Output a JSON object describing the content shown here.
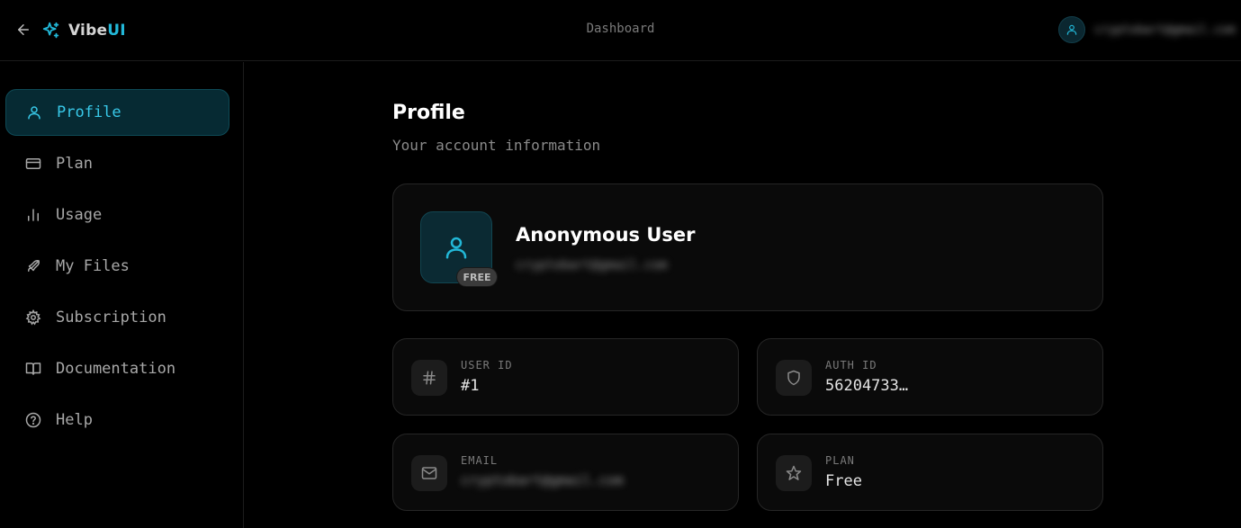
{
  "brand": {
    "name_part1": "Vibe",
    "name_part2": "UI"
  },
  "header": {
    "title": "Dashboard",
    "user_email": "cryptobart@gmail.com"
  },
  "sidebar": {
    "items": [
      {
        "label": "Profile",
        "icon": "user-icon",
        "active": true
      },
      {
        "label": "Plan",
        "icon": "credit-card-icon"
      },
      {
        "label": "Usage",
        "icon": "bar-chart-icon"
      },
      {
        "label": "My Files",
        "icon": "rocket-icon"
      },
      {
        "label": "Subscription",
        "icon": "gear-icon"
      },
      {
        "label": "Documentation",
        "icon": "book-icon"
      },
      {
        "label": "Help",
        "icon": "help-circle-icon"
      }
    ]
  },
  "main": {
    "title": "Profile",
    "subtitle": "Your account information",
    "profile_card": {
      "name": "Anonymous User",
      "email": "cryptobart@gmail.com",
      "badge": "FREE"
    },
    "info": {
      "user_id": {
        "label": "USER ID",
        "value": "#1",
        "icon": "hash-icon"
      },
      "auth_id": {
        "label": "AUTH ID",
        "value": "56204733…",
        "icon": "shield-icon"
      },
      "email": {
        "label": "EMAIL",
        "value": "cryptobart@gmail.com",
        "icon": "mail-icon"
      },
      "plan": {
        "label": "PLAN",
        "value": "Free",
        "icon": "star-icon"
      }
    }
  },
  "colors": {
    "accent": "#22b8d8",
    "background": "#000000",
    "card": "#0a0a0a"
  }
}
